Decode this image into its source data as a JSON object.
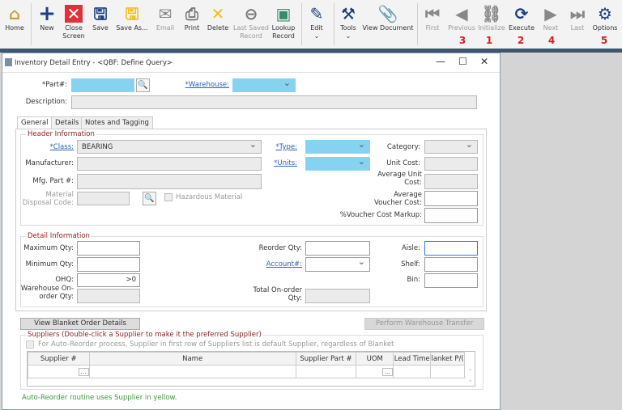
{
  "toolbar": {
    "items": [
      {
        "label": "Home",
        "icon": "home-icon"
      },
      {
        "label": "New",
        "icon": "plus-icon"
      },
      {
        "label": "Close Screen",
        "icon": "close-icon"
      },
      {
        "label": "Save",
        "icon": "save-icon"
      },
      {
        "label": "Save As...",
        "icon": "save-as-icon"
      },
      {
        "label": "Email",
        "icon": "email-icon"
      },
      {
        "label": "Print",
        "icon": "print-icon"
      },
      {
        "label": "Delete",
        "icon": "delete-icon"
      },
      {
        "label": "Last Saved Record",
        "icon": "back-arrow-icon"
      },
      {
        "label": "Lookup Record",
        "icon": "lookup-icon"
      },
      {
        "label": "Edit",
        "icon": "edit-icon"
      },
      {
        "label": "Tools",
        "icon": "tools-icon"
      },
      {
        "label": "View Document",
        "icon": "paperclip-icon"
      },
      {
        "label": "First",
        "icon": "first-icon"
      },
      {
        "label": "Previous",
        "icon": "previous-icon"
      },
      {
        "label": "Initialize",
        "icon": "binoculars-icon"
      },
      {
        "label": "Execute",
        "icon": "refresh-icon"
      },
      {
        "label": "Next",
        "icon": "next-icon"
      },
      {
        "label": "Last",
        "icon": "last-icon"
      },
      {
        "label": "Options",
        "icon": "gear-icon"
      }
    ],
    "step_numbers": {
      "previous": "3",
      "initialize": "1",
      "execute": "2",
      "next": "4",
      "options": "5"
    }
  },
  "window": {
    "title": "Inventory Detail Entry - <QBF: Define Query>"
  },
  "form": {
    "part_label": "*Part#:",
    "warehouse_label": "*Warehouse:",
    "description_label": "Description:",
    "tabs": [
      "General",
      "Details",
      "Notes and Tagging"
    ],
    "header_group": "Header Information",
    "class_label": "*Class:",
    "class_value": "BEARING",
    "manufacturer_label": "Manufacturer:",
    "mfg_part_label": "Mfg. Part #:",
    "material_label": "Material Disposal Code:",
    "hazardous_label": "Hazardous Material",
    "type_label": "*Type:",
    "units_label": "*Units:",
    "category_label": "Category:",
    "unit_cost_label": "Unit Cost:",
    "avg_unit_cost_label": "Average Unit Cost:",
    "avg_voucher_label": "Average Voucher Cost:",
    "markup_label": "%Voucher Cost Markup:",
    "detail_group": "Detail Information",
    "max_qty_label": "Maximum Qty:",
    "min_qty_label": "Minimum Qty:",
    "ohq_label": "OHQ:",
    "ohq_value": ">0",
    "wh_onorder_label": "Warehouse On-order Qty:",
    "reorder_label": "Reorder Qty:",
    "account_label": "Account#:",
    "total_onorder_label": "Total On-order Qty:",
    "aisle_label": "Aisle:",
    "shelf_label": "Shelf:",
    "bin_label": "Bin:",
    "blanket_btn": "View Blanket Order Details",
    "transfer_btn": "Perform Warehouse Transfer",
    "suppliers_group": "Suppliers  (Double-click a Supplier to make it the preferred Supplier)",
    "auto_reorder_check": "For Auto-Reorder process, Supplier in first row of Suppliers list is default Supplier, regardless of Blanket",
    "columns": [
      "Supplier #",
      "Name",
      "Supplier Part #",
      "UOM",
      "Lead Time",
      "lanket P/("
    ],
    "footer_note": "Auto-Reorder routine uses Supplier in yellow."
  }
}
